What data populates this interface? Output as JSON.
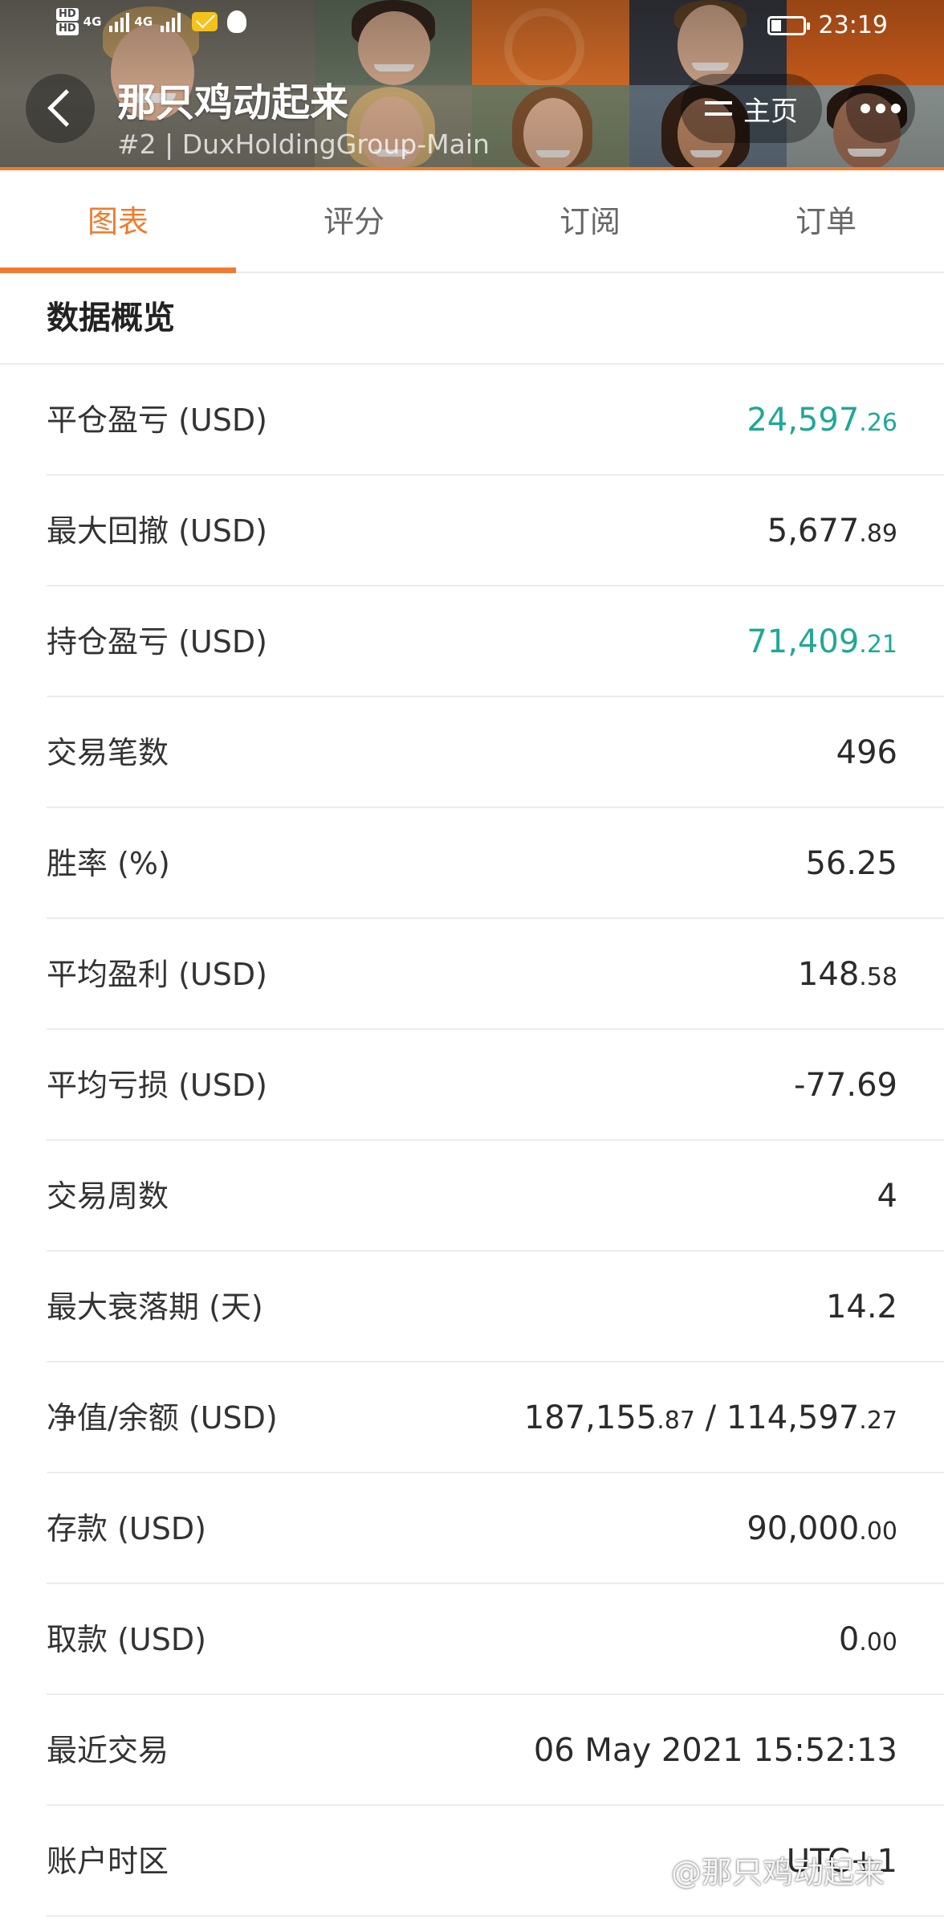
{
  "status_bar": {
    "network_1": "HD",
    "network_2": "HD",
    "signal_1": "4G",
    "signal_2": "4G",
    "time": "23:19"
  },
  "header": {
    "title": "那只鸡动起来",
    "subtitle": "#2 | DuxHoldingGroup-Main",
    "home_label": "主页",
    "accent_color": "#f07b2e"
  },
  "tabs": [
    {
      "label": "图表",
      "active": true
    },
    {
      "label": "评分",
      "active": false
    },
    {
      "label": "订阅",
      "active": false
    },
    {
      "label": "订单",
      "active": false
    }
  ],
  "section": {
    "title": "数据概览"
  },
  "stats": [
    {
      "label": "平仓盈亏 (USD)",
      "int": "24,597",
      "dec": ".26",
      "green": true
    },
    {
      "label": "最大回撤 (USD)",
      "int": "5,677",
      "dec": ".89",
      "green": false
    },
    {
      "label": "持仓盈亏 (USD)",
      "int": "71,409",
      "dec": ".21",
      "green": true
    },
    {
      "label": "交易笔数",
      "int": "496",
      "dec": "",
      "green": false
    },
    {
      "label": "胜率 (%)",
      "int": "56.25",
      "dec": "",
      "green": false
    },
    {
      "label": "平均盈利 (USD)",
      "int": "148",
      "dec": ".58",
      "green": false
    },
    {
      "label": "平均亏损 (USD)",
      "int": "-77.69",
      "dec": "",
      "green": false
    },
    {
      "label": "交易周数",
      "int": "4",
      "dec": "",
      "green": false
    },
    {
      "label": "最大衰落期 (天)",
      "int": "14.2",
      "dec": "",
      "green": false
    },
    {
      "label": "净值/余额 (USD)",
      "int": "187,155",
      "dec": ".87",
      "int2": " / 114,597",
      "dec2": ".27",
      "green": false
    },
    {
      "label": "存款 (USD)",
      "int": "90,000",
      "dec": ".00",
      "green": false
    },
    {
      "label": "取款 (USD)",
      "int": "0",
      "dec": ".00",
      "green": false
    },
    {
      "label": "最近交易",
      "int": "06 May 2021 15:52:13",
      "dec": "",
      "green": false
    },
    {
      "label": "账户时区",
      "int": "UTC+1",
      "dec": "",
      "green": false
    }
  ],
  "watermark": "@那只鸡动起来",
  "colors": {
    "green_value": "#1fa896",
    "tab_active": "#f07b2e"
  }
}
